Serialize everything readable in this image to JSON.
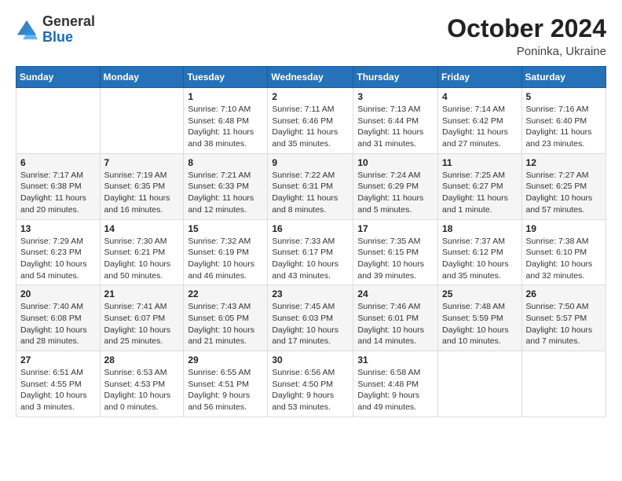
{
  "logo": {
    "general": "General",
    "blue": "Blue"
  },
  "title": "October 2024",
  "location": "Poninka, Ukraine",
  "days_header": [
    "Sunday",
    "Monday",
    "Tuesday",
    "Wednesday",
    "Thursday",
    "Friday",
    "Saturday"
  ],
  "weeks": [
    [
      {
        "day": "",
        "sunrise": "",
        "sunset": "",
        "daylight": ""
      },
      {
        "day": "",
        "sunrise": "",
        "sunset": "",
        "daylight": ""
      },
      {
        "day": "1",
        "sunrise": "Sunrise: 7:10 AM",
        "sunset": "Sunset: 6:48 PM",
        "daylight": "Daylight: 11 hours and 38 minutes."
      },
      {
        "day": "2",
        "sunrise": "Sunrise: 7:11 AM",
        "sunset": "Sunset: 6:46 PM",
        "daylight": "Daylight: 11 hours and 35 minutes."
      },
      {
        "day": "3",
        "sunrise": "Sunrise: 7:13 AM",
        "sunset": "Sunset: 6:44 PM",
        "daylight": "Daylight: 11 hours and 31 minutes."
      },
      {
        "day": "4",
        "sunrise": "Sunrise: 7:14 AM",
        "sunset": "Sunset: 6:42 PM",
        "daylight": "Daylight: 11 hours and 27 minutes."
      },
      {
        "day": "5",
        "sunrise": "Sunrise: 7:16 AM",
        "sunset": "Sunset: 6:40 PM",
        "daylight": "Daylight: 11 hours and 23 minutes."
      }
    ],
    [
      {
        "day": "6",
        "sunrise": "Sunrise: 7:17 AM",
        "sunset": "Sunset: 6:38 PM",
        "daylight": "Daylight: 11 hours and 20 minutes."
      },
      {
        "day": "7",
        "sunrise": "Sunrise: 7:19 AM",
        "sunset": "Sunset: 6:35 PM",
        "daylight": "Daylight: 11 hours and 16 minutes."
      },
      {
        "day": "8",
        "sunrise": "Sunrise: 7:21 AM",
        "sunset": "Sunset: 6:33 PM",
        "daylight": "Daylight: 11 hours and 12 minutes."
      },
      {
        "day": "9",
        "sunrise": "Sunrise: 7:22 AM",
        "sunset": "Sunset: 6:31 PM",
        "daylight": "Daylight: 11 hours and 8 minutes."
      },
      {
        "day": "10",
        "sunrise": "Sunrise: 7:24 AM",
        "sunset": "Sunset: 6:29 PM",
        "daylight": "Daylight: 11 hours and 5 minutes."
      },
      {
        "day": "11",
        "sunrise": "Sunrise: 7:25 AM",
        "sunset": "Sunset: 6:27 PM",
        "daylight": "Daylight: 11 hours and 1 minute."
      },
      {
        "day": "12",
        "sunrise": "Sunrise: 7:27 AM",
        "sunset": "Sunset: 6:25 PM",
        "daylight": "Daylight: 10 hours and 57 minutes."
      }
    ],
    [
      {
        "day": "13",
        "sunrise": "Sunrise: 7:29 AM",
        "sunset": "Sunset: 6:23 PM",
        "daylight": "Daylight: 10 hours and 54 minutes."
      },
      {
        "day": "14",
        "sunrise": "Sunrise: 7:30 AM",
        "sunset": "Sunset: 6:21 PM",
        "daylight": "Daylight: 10 hours and 50 minutes."
      },
      {
        "day": "15",
        "sunrise": "Sunrise: 7:32 AM",
        "sunset": "Sunset: 6:19 PM",
        "daylight": "Daylight: 10 hours and 46 minutes."
      },
      {
        "day": "16",
        "sunrise": "Sunrise: 7:33 AM",
        "sunset": "Sunset: 6:17 PM",
        "daylight": "Daylight: 10 hours and 43 minutes."
      },
      {
        "day": "17",
        "sunrise": "Sunrise: 7:35 AM",
        "sunset": "Sunset: 6:15 PM",
        "daylight": "Daylight: 10 hours and 39 minutes."
      },
      {
        "day": "18",
        "sunrise": "Sunrise: 7:37 AM",
        "sunset": "Sunset: 6:12 PM",
        "daylight": "Daylight: 10 hours and 35 minutes."
      },
      {
        "day": "19",
        "sunrise": "Sunrise: 7:38 AM",
        "sunset": "Sunset: 6:10 PM",
        "daylight": "Daylight: 10 hours and 32 minutes."
      }
    ],
    [
      {
        "day": "20",
        "sunrise": "Sunrise: 7:40 AM",
        "sunset": "Sunset: 6:08 PM",
        "daylight": "Daylight: 10 hours and 28 minutes."
      },
      {
        "day": "21",
        "sunrise": "Sunrise: 7:41 AM",
        "sunset": "Sunset: 6:07 PM",
        "daylight": "Daylight: 10 hours and 25 minutes."
      },
      {
        "day": "22",
        "sunrise": "Sunrise: 7:43 AM",
        "sunset": "Sunset: 6:05 PM",
        "daylight": "Daylight: 10 hours and 21 minutes."
      },
      {
        "day": "23",
        "sunrise": "Sunrise: 7:45 AM",
        "sunset": "Sunset: 6:03 PM",
        "daylight": "Daylight: 10 hours and 17 minutes."
      },
      {
        "day": "24",
        "sunrise": "Sunrise: 7:46 AM",
        "sunset": "Sunset: 6:01 PM",
        "daylight": "Daylight: 10 hours and 14 minutes."
      },
      {
        "day": "25",
        "sunrise": "Sunrise: 7:48 AM",
        "sunset": "Sunset: 5:59 PM",
        "daylight": "Daylight: 10 hours and 10 minutes."
      },
      {
        "day": "26",
        "sunrise": "Sunrise: 7:50 AM",
        "sunset": "Sunset: 5:57 PM",
        "daylight": "Daylight: 10 hours and 7 minutes."
      }
    ],
    [
      {
        "day": "27",
        "sunrise": "Sunrise: 6:51 AM",
        "sunset": "Sunset: 4:55 PM",
        "daylight": "Daylight: 10 hours and 3 minutes."
      },
      {
        "day": "28",
        "sunrise": "Sunrise: 6:53 AM",
        "sunset": "Sunset: 4:53 PM",
        "daylight": "Daylight: 10 hours and 0 minutes."
      },
      {
        "day": "29",
        "sunrise": "Sunrise: 6:55 AM",
        "sunset": "Sunset: 4:51 PM",
        "daylight": "Daylight: 9 hours and 56 minutes."
      },
      {
        "day": "30",
        "sunrise": "Sunrise: 6:56 AM",
        "sunset": "Sunset: 4:50 PM",
        "daylight": "Daylight: 9 hours and 53 minutes."
      },
      {
        "day": "31",
        "sunrise": "Sunrise: 6:58 AM",
        "sunset": "Sunset: 4:48 PM",
        "daylight": "Daylight: 9 hours and 49 minutes."
      },
      {
        "day": "",
        "sunrise": "",
        "sunset": "",
        "daylight": ""
      },
      {
        "day": "",
        "sunrise": "",
        "sunset": "",
        "daylight": ""
      }
    ]
  ]
}
